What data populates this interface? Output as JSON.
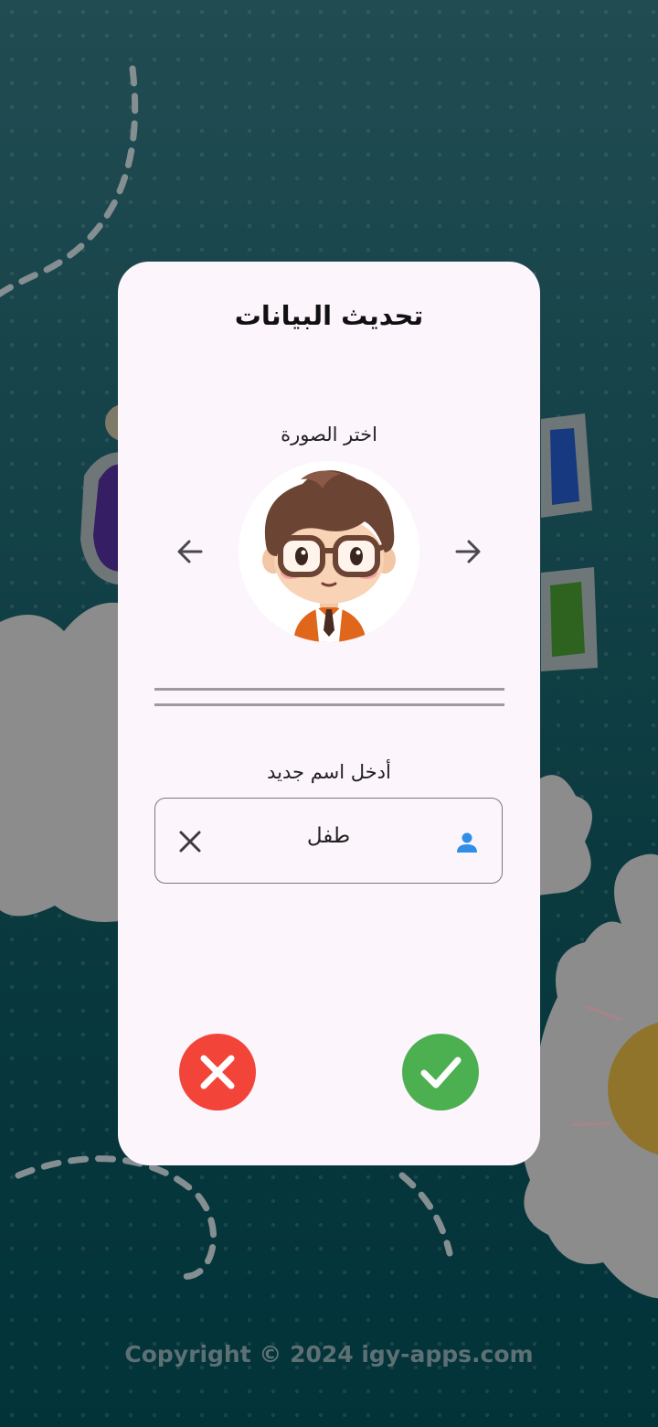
{
  "dialog": {
    "title": "تحديث البيانات",
    "image_picker": {
      "label": "اختر الصورة",
      "avatar_icon": "boy-with-glasses-avatar",
      "prev_icon": "arrow-left-icon",
      "next_icon": "arrow-right-icon"
    },
    "name_field": {
      "label": "أدخل اسم جديد",
      "value": "طفل",
      "clear_icon": "close-icon",
      "leading_icon": "person-icon"
    },
    "actions": {
      "cancel_icon": "close-icon",
      "confirm_icon": "check-icon"
    }
  },
  "footer": {
    "copyright": "Copyright © 2024 igy-apps.com"
  },
  "colors": {
    "dialog_bg": "#fdf5fc",
    "cancel": "#f3443a",
    "confirm": "#4caf50",
    "person_icon": "#2f8fe8"
  }
}
